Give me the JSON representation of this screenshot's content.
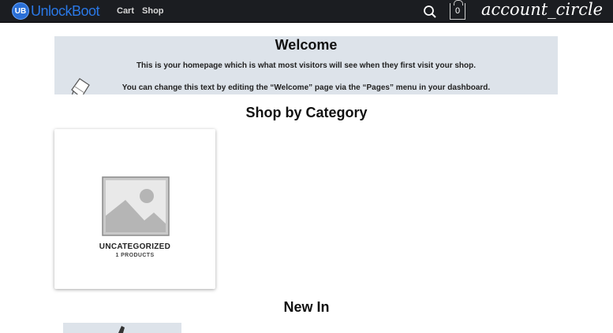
{
  "header": {
    "logo_badge": "UB",
    "logo_text": "UnlockBoot",
    "nav": [
      {
        "label": "Cart"
      },
      {
        "label": "Shop"
      }
    ],
    "cart_count": "0",
    "account_label": "account_circle"
  },
  "welcome": {
    "title": "Welcome",
    "line1": "This is your homepage which is what most visitors will see when they first visit your shop.",
    "line2": "You can change this text by editing the “Welcome” page via the “Pages” menu in your dashboard."
  },
  "shop_by_category": {
    "title": "Shop by Category",
    "categories": [
      {
        "name": "UNCATEGORIZED",
        "count": "1 PRODUCTS"
      }
    ]
  },
  "new_in": {
    "title": "New In"
  },
  "colors": {
    "topbar": "#1b1d21",
    "welcome_bg": "#dde3ea",
    "logo_blue": "#2a78e6"
  }
}
